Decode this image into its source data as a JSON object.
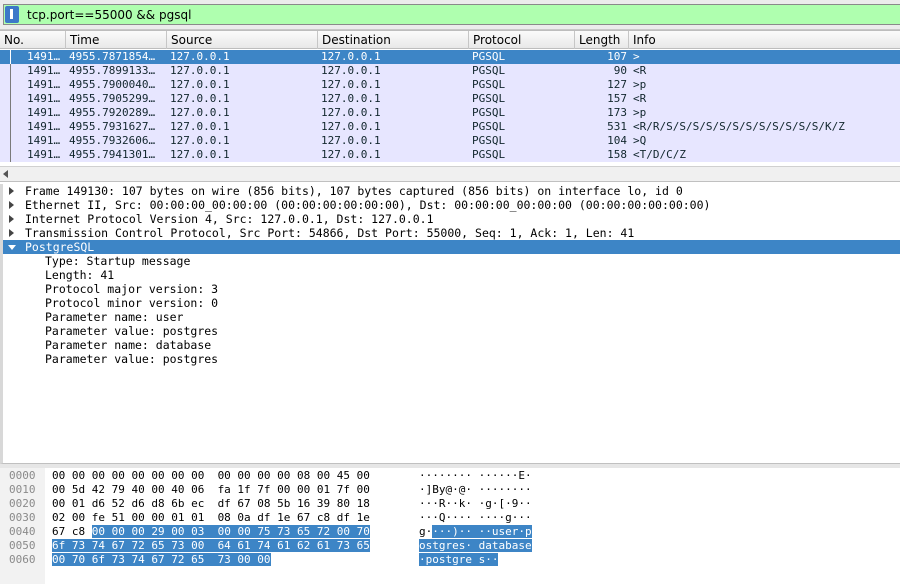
{
  "filter": {
    "value": "tcp.port==55000 && pgsql",
    "background": "#afffaf"
  },
  "packet_list": {
    "columns": [
      "No.",
      "Time",
      "Source",
      "Destination",
      "Protocol",
      "Length",
      "Info"
    ],
    "rows": [
      {
        "no": "1491…",
        "time": "4955.7871854…",
        "src": "127.0.0.1",
        "dst": "127.0.0.1",
        "proto": "PGSQL",
        "len": "107",
        "info": ">"
      },
      {
        "no": "1491…",
        "time": "4955.7899133…",
        "src": "127.0.0.1",
        "dst": "127.0.0.1",
        "proto": "PGSQL",
        "len": "90",
        "info": "<R"
      },
      {
        "no": "1491…",
        "time": "4955.7900040…",
        "src": "127.0.0.1",
        "dst": "127.0.0.1",
        "proto": "PGSQL",
        "len": "127",
        "info": ">p"
      },
      {
        "no": "1491…",
        "time": "4955.7905299…",
        "src": "127.0.0.1",
        "dst": "127.0.0.1",
        "proto": "PGSQL",
        "len": "157",
        "info": "<R"
      },
      {
        "no": "1491…",
        "time": "4955.7920289…",
        "src": "127.0.0.1",
        "dst": "127.0.0.1",
        "proto": "PGSQL",
        "len": "173",
        "info": ">p"
      },
      {
        "no": "1491…",
        "time": "4955.7931627…",
        "src": "127.0.0.1",
        "dst": "127.0.0.1",
        "proto": "PGSQL",
        "len": "531",
        "info": "<R/R/S/S/S/S/S/S/S/S/S/S/S/S/K/Z"
      },
      {
        "no": "1491…",
        "time": "4955.7932606…",
        "src": "127.0.0.1",
        "dst": "127.0.0.1",
        "proto": "PGSQL",
        "len": "104",
        "info": ">Q"
      },
      {
        "no": "1491…",
        "time": "4955.7941301…",
        "src": "127.0.0.1",
        "dst": "127.0.0.1",
        "proto": "PGSQL",
        "len": "158",
        "info": "<T/D/C/Z"
      }
    ],
    "row_color": "#e7e6ff",
    "selected_color": "#3d85c6"
  },
  "details": {
    "frame": "Frame 149130: 107 bytes on wire (856 bits), 107 bytes captured (856 bits) on interface lo, id 0",
    "ethernet": "Ethernet II, Src: 00:00:00_00:00:00 (00:00:00:00:00:00), Dst: 00:00:00_00:00:00 (00:00:00:00:00:00)",
    "ip": "Internet Protocol Version 4, Src: 127.0.0.1, Dst: 127.0.0.1",
    "tcp": "Transmission Control Protocol, Src Port: 54866, Dst Port: 55000, Seq: 1, Ack: 1, Len: 41",
    "pgsql": "PostgreSQL",
    "fields": [
      "Type: Startup message",
      "Length: 41",
      "Protocol major version: 3",
      "Protocol minor version: 0",
      "Parameter name: user",
      "Parameter value: postgres",
      "Parameter name: database",
      "Parameter value: postgres"
    ]
  },
  "bytes": {
    "rows": [
      {
        "offset": "0000",
        "hex": "00 00 00 00 00 00 00 00  00 00 00 00 08 00 45 00",
        "hex_hl": "",
        "ascii": "········ ······E·",
        "ascii_hl": ""
      },
      {
        "offset": "0010",
        "hex": "00 5d 42 79 40 00 40 06  fa 1f 7f 00 00 01 7f 00",
        "hex_hl": "",
        "ascii": "·]By@·@· ········",
        "ascii_hl": ""
      },
      {
        "offset": "0020",
        "hex": "00 01 d6 52 d6 d8 6b ec  df 67 08 5b 16 39 80 18",
        "hex_hl": "",
        "ascii": "···R··k· ·g·[·9··",
        "ascii_hl": ""
      },
      {
        "offset": "0030",
        "hex": "02 00 fe 51 00 00 01 01  08 0a df 1e 67 c8 df 1e",
        "hex_hl": "",
        "ascii": "···Q···· ····g···",
        "ascii_hl": ""
      },
      {
        "offset": "0040",
        "hex": "67 c8 ",
        "hex_hl": "00 00 00 29 00 03  00 00 75 73 65 72 00 70",
        "ascii": "g·",
        "ascii_hl": "···)·· ··user·p"
      },
      {
        "offset": "0050",
        "hex": "",
        "hex_hl": "6f 73 74 67 72 65 73 00  64 61 74 61 62 61 73 65",
        "ascii": "",
        "ascii_hl": "ostgres· database"
      },
      {
        "offset": "0060",
        "hex": "",
        "hex_hl": "00 70 6f 73 74 67 72 65  73 00 00",
        "ascii": "",
        "ascii_hl": "·postgre s··"
      }
    ]
  }
}
